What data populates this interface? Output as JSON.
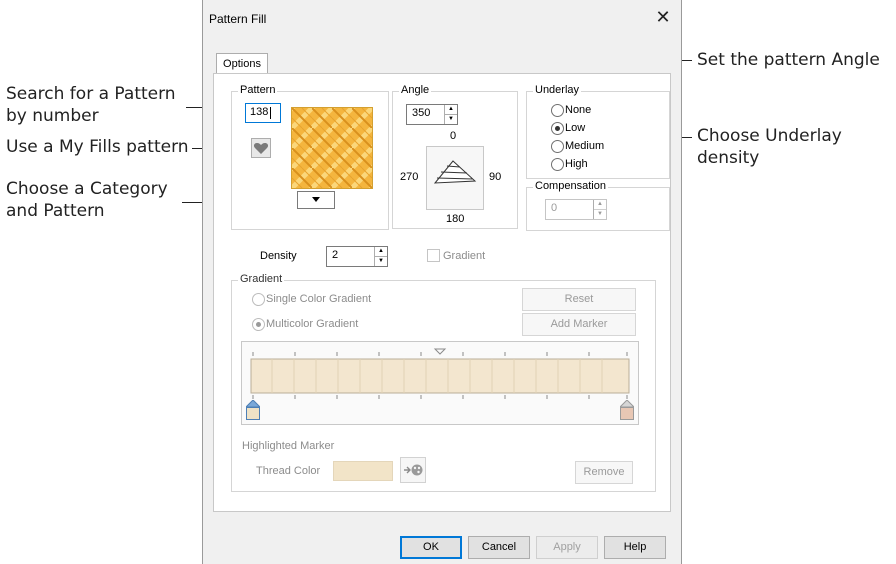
{
  "annotations": {
    "search_line1": "Search for a Pattern",
    "search_line2": "by number",
    "myfills": "Use a My Fills pattern",
    "category_line1": "Choose a Category",
    "category_line2": "and Pattern",
    "angle": "Set the pattern Angle",
    "underlay_line1": "Choose Underlay",
    "underlay_line2": "density"
  },
  "dialog": {
    "title": "Pattern Fill",
    "close_glyph": "✕",
    "tab_options": "Options"
  },
  "pattern": {
    "group_label": "Pattern",
    "number_value": "138"
  },
  "angle": {
    "group_label": "Angle",
    "value": "350",
    "dial_0": "0",
    "dial_90": "90",
    "dial_180": "180",
    "dial_270": "270"
  },
  "underlay": {
    "group_label": "Underlay",
    "options": [
      "None",
      "Low",
      "Medium",
      "High"
    ],
    "selected": "Low"
  },
  "compensation": {
    "group_label": "Compensation",
    "value": "0"
  },
  "density": {
    "label": "Density",
    "value": "2",
    "gradient_checkbox_label": "Gradient"
  },
  "gradient": {
    "group_label": "Gradient",
    "single_label": "Single Color Gradient",
    "multi_label": "Multicolor Gradient",
    "selected": "Multicolor Gradient",
    "reset_label": "Reset",
    "add_marker_label": "Add Marker",
    "highlighted_marker_label": "Highlighted Marker",
    "thread_color_label": "Thread Color",
    "remove_label": "Remove",
    "bar_color": "#f3e6cf",
    "left_marker_color": "#efe2c6",
    "right_marker_color": "#e8c7b4"
  },
  "footer": {
    "ok": "OK",
    "cancel": "Cancel",
    "apply": "Apply",
    "help": "Help"
  }
}
